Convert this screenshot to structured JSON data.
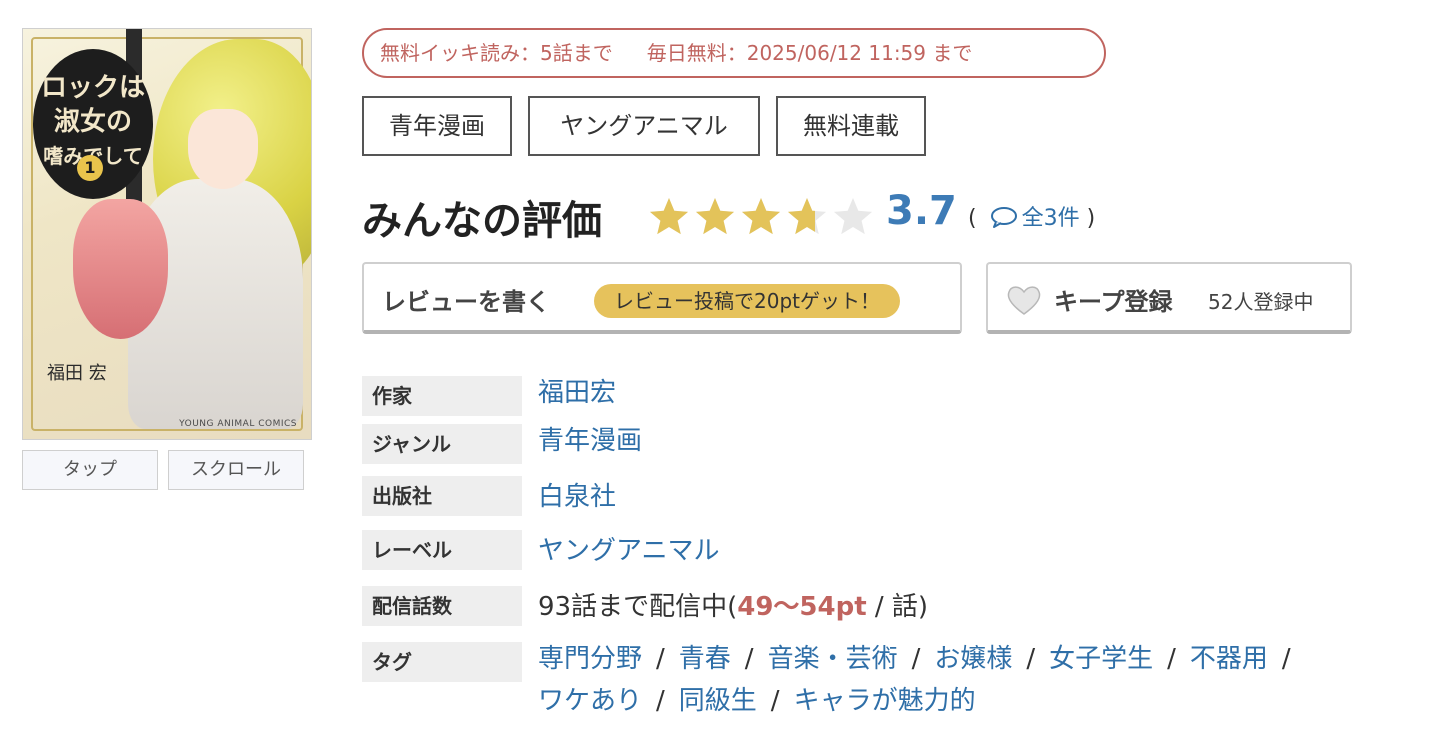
{
  "cover": {
    "title_lines": [
      "ロックは",
      "淑女の",
      "嗜みでして"
    ],
    "volume": "1",
    "author": "福田 宏",
    "label_text": "YOUNG ANIMAL COMICS"
  },
  "view_modes": {
    "tap": "タップ",
    "scroll": "スクロール"
  },
  "free_notice": {
    "ikki": "無料イッキ読み：5話まで",
    "daily": "毎日無料：2025/06/12 11:59 まで"
  },
  "tags_top": [
    "青年漫画",
    "ヤングアニマル",
    "無料連載"
  ],
  "rating": {
    "title": "みんなの評価",
    "value": "3.7",
    "stars_value": 3.7,
    "stars_max": 5,
    "count_open": "(",
    "count_text": "全3件",
    "count_close": ")"
  },
  "review_button": {
    "label": "レビューを書く",
    "badge": "レビュー投稿で20ptゲット！"
  },
  "keep_button": {
    "label": "キープ登録",
    "count": "52人登録中"
  },
  "info": {
    "author_label": "作家",
    "author_value": "福田宏",
    "genre_label": "ジャンル",
    "genre_value": "青年漫画",
    "publisher_label": "出版社",
    "publisher_value": "白泉社",
    "label_label": "レーベル",
    "label_value": "ヤングアニマル",
    "episodes_label": "配信話数",
    "episodes_prefix": "93話まで配信中(",
    "episodes_price": "49〜54pt",
    "episodes_suffix": " / 話)",
    "tags_label": "タグ",
    "tags": [
      "専門分野",
      "青春",
      "音楽・芸術",
      "お嬢様",
      "女子学生",
      "不器用",
      "ワケあり",
      "同級生",
      "キャラが魅力的"
    ]
  },
  "colors": {
    "accent_red": "#c0645f",
    "link_blue": "#2f6fa8",
    "star_gold": "#e3c35a",
    "badge_gold": "#e6c25c",
    "rating_blue": "#3d7bb6"
  },
  "icons": {
    "star": "star-icon",
    "bubble": "speech-bubble-icon",
    "heart": "heart-icon"
  }
}
